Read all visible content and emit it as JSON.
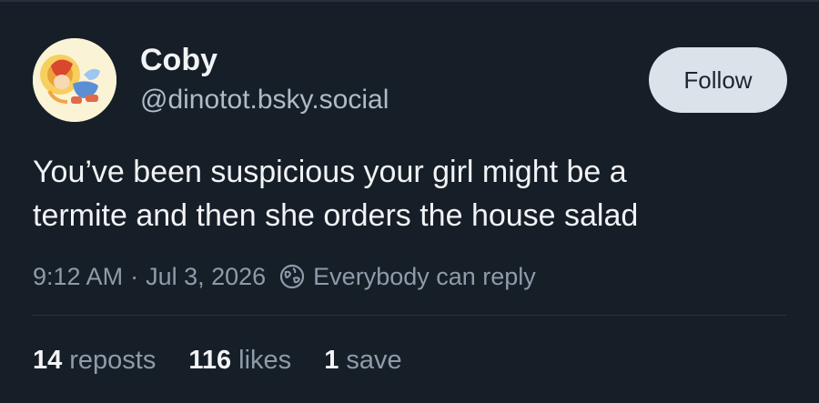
{
  "author": {
    "display_name": "Coby",
    "handle": "@dinotot.bsky.social",
    "avatar_icon": "avatar-cartoon-character"
  },
  "follow_button_label": "Follow",
  "post": {
    "text_lines": [
      "You’ve been suspicious your girl might be a",
      "termite and then she orders the house salad"
    ],
    "time": "9:12 AM",
    "separator": "·",
    "date": "Jul 3, 2026",
    "reply_setting": "Everybody can reply",
    "reply_icon": "globe-reply-icon"
  },
  "stats": {
    "reposts": {
      "count": "14",
      "label": "reposts"
    },
    "likes": {
      "count": "116",
      "label": "likes"
    },
    "saves": {
      "count": "1",
      "label": "save"
    }
  },
  "colors": {
    "background": "#161e27",
    "text": "#f1f3f5",
    "muted": "#8e9bab",
    "button_bg": "#dce2ea"
  }
}
